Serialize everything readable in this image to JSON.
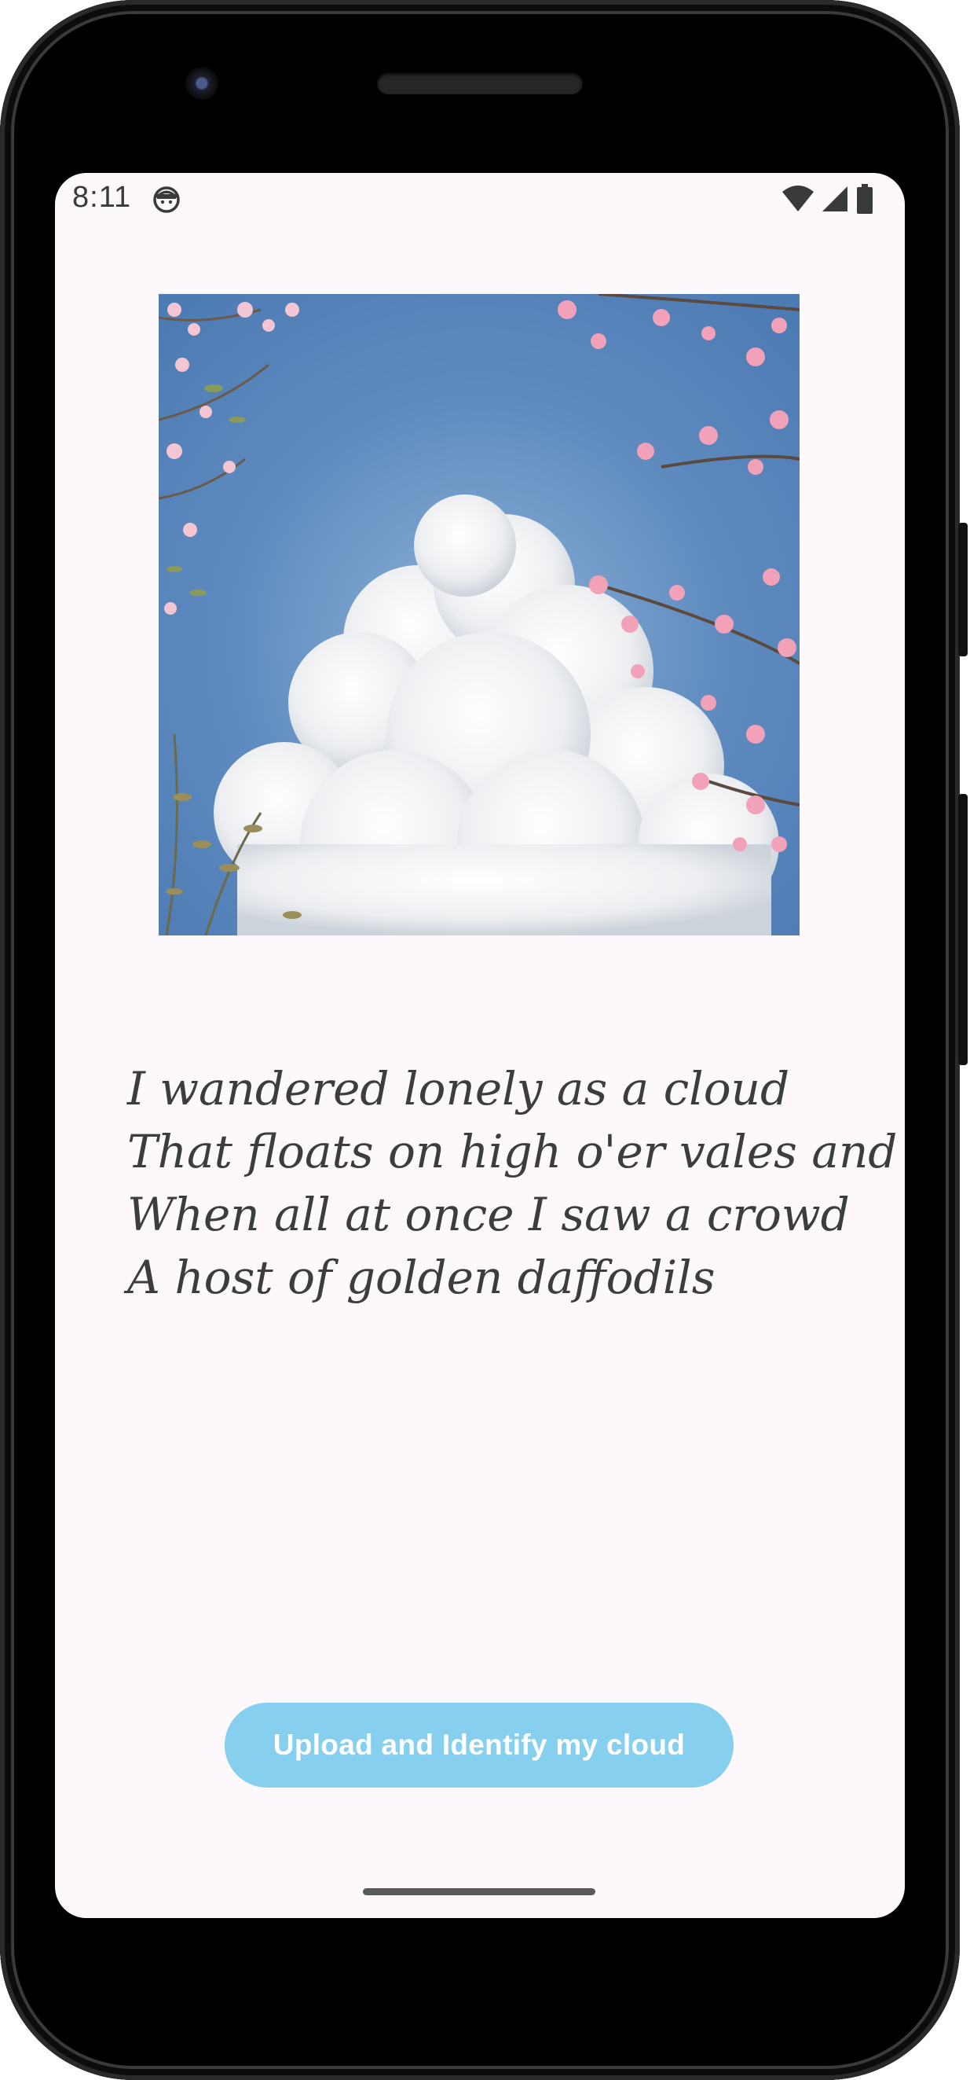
{
  "status_bar": {
    "time": "8:11",
    "app_icon": "android-face-icon",
    "icons": [
      "wifi-icon",
      "cellular-signal-icon",
      "battery-icon"
    ]
  },
  "hero_image": {
    "subject": "cumulus cloud in blue sky framed by pink cherry blossom branches",
    "colors": {
      "sky": "#5b86ba",
      "cloud": "#f1f2f4",
      "blossom": "#f2a2b8"
    }
  },
  "poem": {
    "lines": [
      "I wandered lonely as a cloud",
      "That floats on high o'er vales and hills",
      "When all at once I saw a crowd",
      " A host of golden daffodils"
    ]
  },
  "actions": {
    "upload_button_label": "Upload and Identify my cloud"
  },
  "theme": {
    "screen_background": "#fcf8fb",
    "button_background": "#86cfee",
    "button_text": "#ffffff",
    "text": "#3d3d3d"
  }
}
